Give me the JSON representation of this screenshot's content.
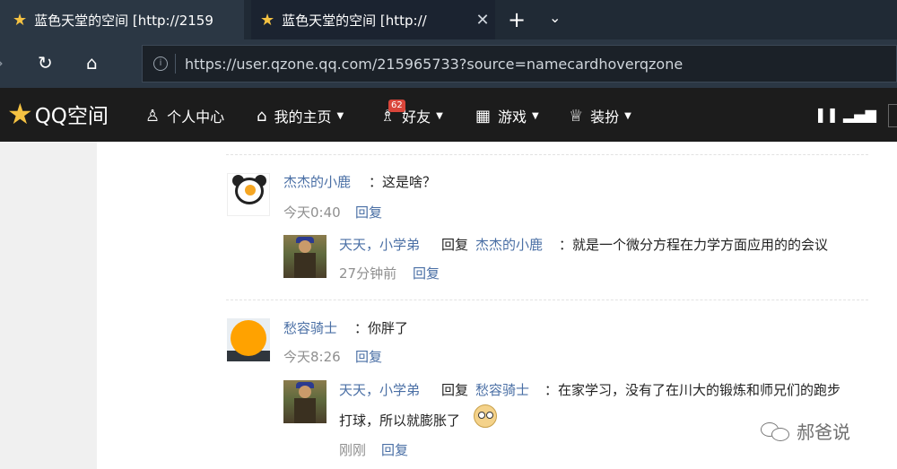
{
  "browser": {
    "tabs": [
      {
        "title": "蓝色天堂的空间 [http://2159",
        "active": false
      },
      {
        "title": "蓝色天堂的空间 [http://",
        "active": true
      }
    ],
    "close_glyph": "✕",
    "new_tab_glyph": "+",
    "tab_menu_glyph": "⌄",
    "refresh_glyph": "↻",
    "home_glyph": "⌂",
    "back_glyph": "›",
    "info_glyph": "i",
    "url": "https://user.qzone.qq.com/215965733?source=namecardhoverqzone"
  },
  "qqnav": {
    "logo_text": "QQ空间",
    "items": [
      {
        "label": "个人中心",
        "icon": "person-icon"
      },
      {
        "label": "我的主页",
        "icon": "home-icon"
      },
      {
        "label": "好友",
        "icon": "friends-icon",
        "badge": "62"
      },
      {
        "label": "游戏",
        "icon": "grid-icon"
      },
      {
        "label": "装扮",
        "icon": "shirt-icon"
      }
    ],
    "caret": "▼"
  },
  "comments": [
    {
      "author": "杰杰的小鹿",
      "text": "：这是啥？",
      "time": "今天0:40",
      "reply_label": "回复",
      "reply": {
        "author": "天天，小学弟",
        "verb": "回复",
        "target": "杰杰的小鹿",
        "text": "：就是一个微分方程在力学方面应用的的会议",
        "time": "27分钟前",
        "reply_label": "回复"
      }
    },
    {
      "author": "愁容骑士",
      "text": "：你胖了",
      "time": "今天8:26",
      "reply_label": "回复",
      "reply": {
        "author": "天天，小学弟",
        "verb": "回复",
        "target": "愁容骑士",
        "text_line1": "：在家学习，没有了在川大的锻炼和师兄们的跑步",
        "text_line2": "打球，所以就膨胀了",
        "time": "刚刚",
        "reply_label": "回复"
      }
    }
  ],
  "watermark": "郝爸说",
  "colors": {
    "link": "#4a6fa5",
    "nav_bg": "#1c1c1c",
    "badge": "#d9453a",
    "star": "#f5c242"
  }
}
